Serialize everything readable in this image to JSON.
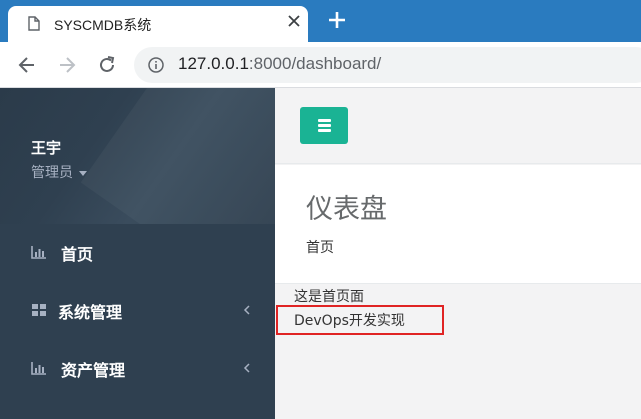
{
  "browser": {
    "tab_title": "SYSCMDB系统",
    "url_host": "127.0.0.1",
    "url_rest": ":8000/dashboard/"
  },
  "sidebar": {
    "user_name": "王宇",
    "user_role": "管理员",
    "items": [
      {
        "label": "首页",
        "icon": "bar-chart-icon",
        "has_arrow": false
      },
      {
        "label": "系统管理",
        "icon": "grid-icon",
        "has_arrow": true
      },
      {
        "label": "资产管理",
        "icon": "bar-chart-icon",
        "has_arrow": true
      }
    ]
  },
  "header": {
    "menu_toggle_icon": "hamburger-icon"
  },
  "page": {
    "title": "仪表盘",
    "breadcrumb": "首页"
  },
  "content": {
    "line1": "这是首页面",
    "line2": "DevOps开发实现"
  },
  "colors": {
    "sidebar_bg": "#2f4050",
    "accent": "#1ab394",
    "highlight": "#e02424",
    "tabbar": "#2a7bbf"
  }
}
